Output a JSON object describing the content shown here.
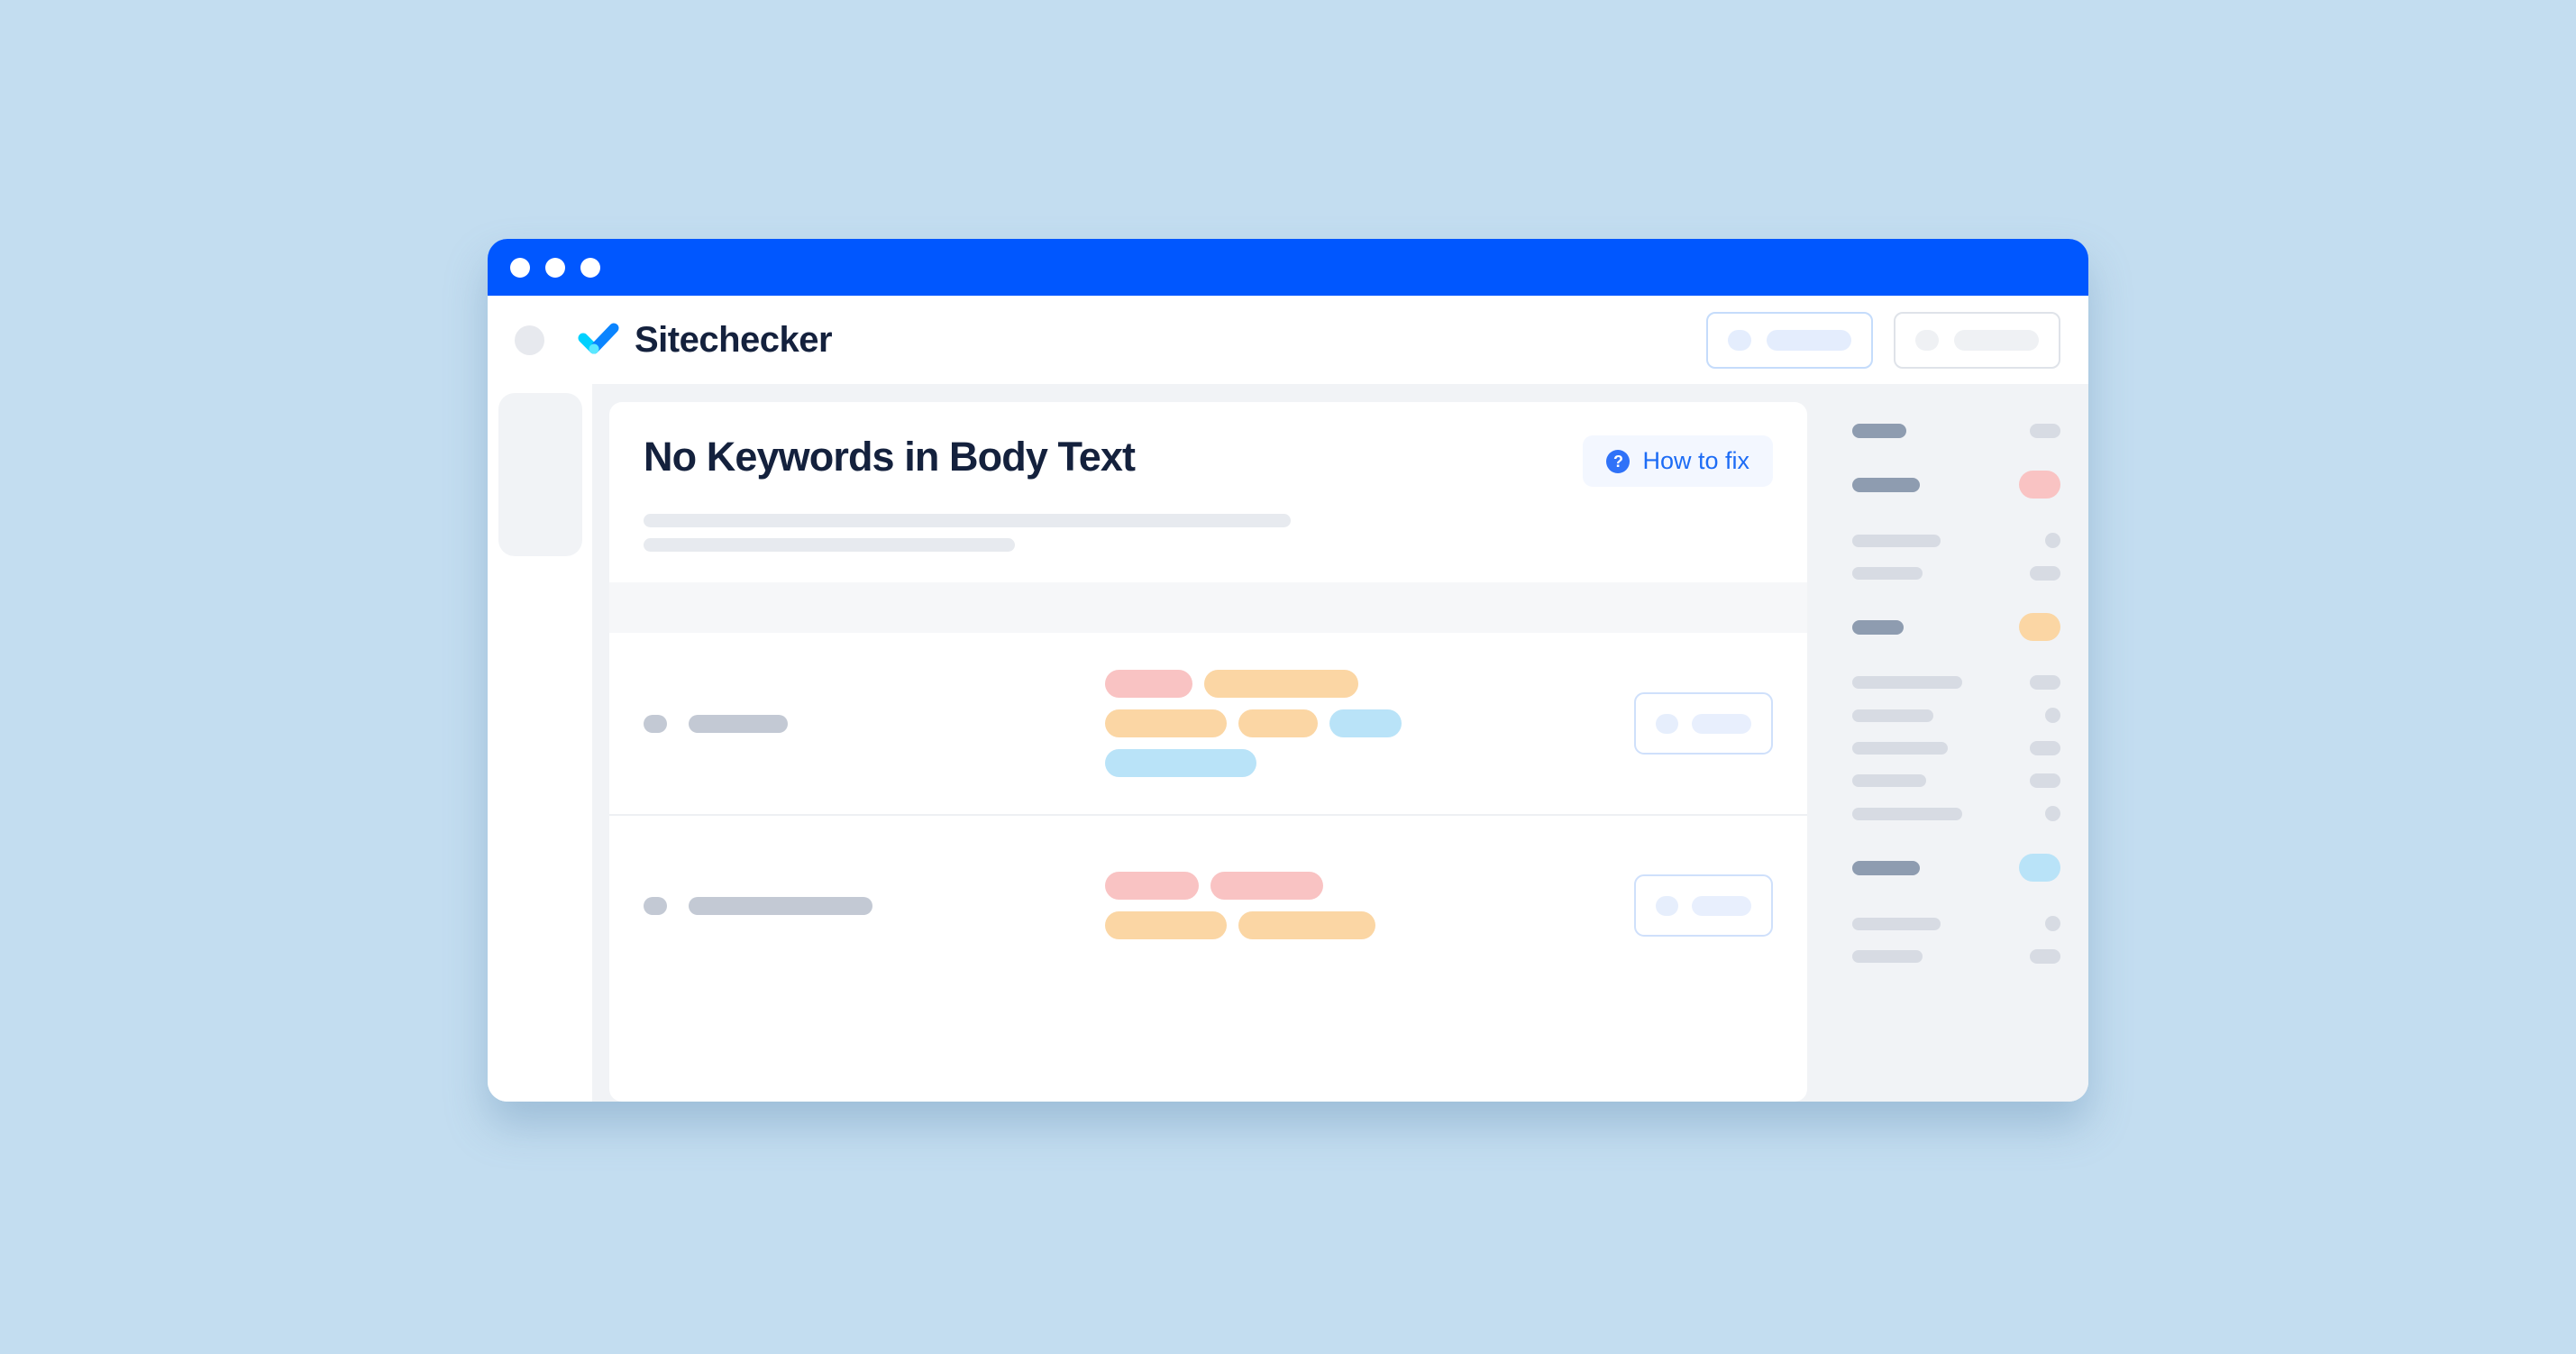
{
  "background_color": "#C3DDF0",
  "window": {
    "titlebar": {
      "color": "#0057FF",
      "traffic_lights": [
        "close",
        "minimize",
        "maximize"
      ]
    }
  },
  "header": {
    "avatar_icon": "avatar-circle",
    "brand_name": "Sitechecker",
    "logo_icon": "checkmark-logo",
    "logo_colors": {
      "left": "#00D1FF",
      "right": "#0A84FF",
      "overlap": "#5BE8FF"
    },
    "actions": [
      {
        "name": "primary-placeholder-button",
        "style": "accent"
      },
      {
        "name": "secondary-placeholder-button",
        "style": "ghost"
      }
    ]
  },
  "left_rail": {
    "items": [
      {
        "icon": "nav-circle-icon-1"
      },
      {
        "icon": "nav-circle-icon-2"
      },
      {
        "icon": "nav-circle-icon-3"
      },
      {
        "icon": "nav-circle-icon-4"
      }
    ]
  },
  "main": {
    "title": "No Keywords in Body Text",
    "how_to_fix": {
      "label": "How to fix",
      "icon": "question-mark-icon",
      "text_color": "#1D6CF5",
      "bg_color": "#F3F7FF"
    },
    "subtitle_lines": [
      718,
      412
    ],
    "table": {
      "header_strip": true,
      "rows": [
        {
          "label_bar_width": 110,
          "pill_lines": [
            [
              {
                "w": 97,
                "color": "#F9C3C3"
              },
              {
                "w": 171,
                "color": "#FBD6A4"
              }
            ],
            [
              {
                "w": 135,
                "color": "#FBD6A4"
              },
              {
                "w": 88,
                "color": "#FBD6A4"
              },
              {
                "w": 80,
                "color": "#B9E3F8"
              }
            ],
            [
              {
                "w": 168,
                "color": "#B9E3F8"
              }
            ]
          ],
          "action": "row-action-button"
        },
        {
          "label_bar_width": 204,
          "pill_lines": [
            [
              {
                "w": 104,
                "color": "#F9C3C3"
              },
              {
                "w": 125,
                "color": "#F9C3C3"
              }
            ],
            [
              {
                "w": 135,
                "color": "#FBD6A4"
              },
              {
                "w": 152,
                "color": "#FBD6A4"
              }
            ]
          ],
          "action": "row-action-button"
        }
      ]
    }
  },
  "right_panel": {
    "groups": [
      {
        "head": {
          "w": 60,
          "badge": "pill-sm",
          "badge_color": "#D7DBE3"
        },
        "subs": []
      },
      {
        "head": {
          "w": 75,
          "badge": "big",
          "badge_color": "#F9C3C3"
        },
        "subs": [
          {
            "w": 98,
            "badge": "dot-sm"
          },
          {
            "w": 78,
            "badge": "pill-sm"
          }
        ]
      },
      {
        "head": {
          "w": 57,
          "badge": "big",
          "badge_color": "#FBD6A4"
        },
        "subs": [
          {
            "w": 122,
            "badge": "pill-sm"
          },
          {
            "w": 90,
            "badge": "dot-sm"
          },
          {
            "w": 106,
            "badge": "pill-sm"
          },
          {
            "w": 82,
            "badge": "pill-sm"
          },
          {
            "w": 122,
            "badge": "dot-sm"
          }
        ]
      },
      {
        "head": {
          "w": 75,
          "badge": "big",
          "badge_color": "#B9E3F8"
        },
        "subs": [
          {
            "w": 98,
            "badge": "dot-sm"
          },
          {
            "w": 78,
            "badge": "pill-sm"
          }
        ]
      }
    ]
  }
}
